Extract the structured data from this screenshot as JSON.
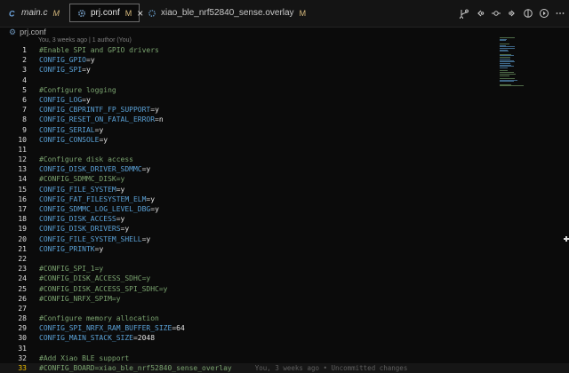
{
  "tabs": [
    {
      "label": "main.c",
      "status": "M",
      "icon": "c-file-icon",
      "active": false
    },
    {
      "label": "prj.conf",
      "status": "M",
      "icon": "gear-icon",
      "active": true
    },
    {
      "label": "xiao_ble_nrf52840_sense.overlay",
      "status": "M",
      "icon": "device-tree-icon",
      "active": false
    }
  ],
  "actions": [
    "source-control-icon",
    "go-back-icon",
    "go-prev-change-icon",
    "go-next-change-icon",
    "compare-icon",
    "run-icon",
    "more-icon"
  ],
  "breadcrumb": {
    "file": "prj.conf"
  },
  "codelens": "You, 3 weeks ago | 1 author (You)",
  "lines": [
    {
      "n": "1",
      "type": "comment",
      "text": "#Enable SPI and GPIO drivers"
    },
    {
      "n": "2",
      "type": "kv",
      "key": "CONFIG_GPIO",
      "value": "y"
    },
    {
      "n": "3",
      "type": "kv",
      "key": "CONFIG_SPI",
      "value": "y"
    },
    {
      "n": "4",
      "type": "blank"
    },
    {
      "n": "5",
      "type": "comment",
      "text": "#Configure logging"
    },
    {
      "n": "6",
      "type": "kv",
      "key": "CONFIG_LOG",
      "value": "y"
    },
    {
      "n": "7",
      "type": "kv",
      "key": "CONFIG_CBPRINTF_FP_SUPPORT",
      "value": "y"
    },
    {
      "n": "8",
      "type": "kv",
      "key": "CONFIG_RESET_ON_FATAL_ERROR",
      "value": "n"
    },
    {
      "n": "9",
      "type": "kv",
      "key": "CONFIG_SERIAL",
      "value": "y"
    },
    {
      "n": "10",
      "type": "kv",
      "key": "CONFIG_CONSOLE",
      "value": "y"
    },
    {
      "n": "11",
      "type": "blank"
    },
    {
      "n": "12",
      "type": "comment",
      "text": "#Configure disk access"
    },
    {
      "n": "13",
      "type": "kv",
      "key": "CONFIG_DISK_DRIVER_SDMMC",
      "value": "y"
    },
    {
      "n": "14",
      "type": "comment",
      "text": "#CONFIG_SDMMC_DISK=y"
    },
    {
      "n": "15",
      "type": "kv",
      "key": "CONFIG_FILE_SYSTEM",
      "value": "y"
    },
    {
      "n": "16",
      "type": "kv",
      "key": "CONFIG_FAT_FILESYSTEM_ELM",
      "value": "y"
    },
    {
      "n": "17",
      "type": "kv",
      "key": "CONFIG_SDMMC_LOG_LEVEL_DBG",
      "value": "y"
    },
    {
      "n": "18",
      "type": "kv",
      "key": "CONFIG_DISK_ACCESS",
      "value": "y"
    },
    {
      "n": "19",
      "type": "kv",
      "key": "CONFIG_DISK_DRIVERS",
      "value": "y"
    },
    {
      "n": "20",
      "type": "kv",
      "key": "CONFIG_FILE_SYSTEM_SHELL",
      "value": "y"
    },
    {
      "n": "21",
      "type": "kv",
      "key": "CONFIG_PRINTK",
      "value": "y"
    },
    {
      "n": "22",
      "type": "blank"
    },
    {
      "n": "23",
      "type": "comment",
      "text": "#CONFIG_SPI_1=y"
    },
    {
      "n": "24",
      "type": "comment",
      "text": "#CONFIG_DISK_ACCESS_SDHC=y"
    },
    {
      "n": "25",
      "type": "comment",
      "text": "#CONFIG_DISK_ACCESS_SPI_SDHC=y"
    },
    {
      "n": "26",
      "type": "comment",
      "text": "#CONFIG_NRFX_SPIM=y"
    },
    {
      "n": "27",
      "type": "blank"
    },
    {
      "n": "28",
      "type": "comment",
      "text": "#Configure memory allocation"
    },
    {
      "n": "29",
      "type": "kv",
      "key": "CONFIG_SPI_NRFX_RAM_BUFFER_SIZE",
      "value": "64"
    },
    {
      "n": "30",
      "type": "kv",
      "key": "CONFIG_MAIN_STACK_SIZE",
      "value": "2048"
    },
    {
      "n": "31",
      "type": "blank"
    },
    {
      "n": "32",
      "type": "comment",
      "text": "#Add Xiao BLE support"
    },
    {
      "n": "33",
      "type": "comment",
      "text": "#CONFIG_BOARD=xiao_ble_nrf52840_sense_overlay",
      "current": true,
      "blame": "You, 3 weeks ago • Uncommitted changes"
    }
  ],
  "colors": {
    "key": "#5aa1d6",
    "comment": "#7aa36f",
    "modified": "#d7ba7d",
    "current_line_number": "#f0c000"
  }
}
